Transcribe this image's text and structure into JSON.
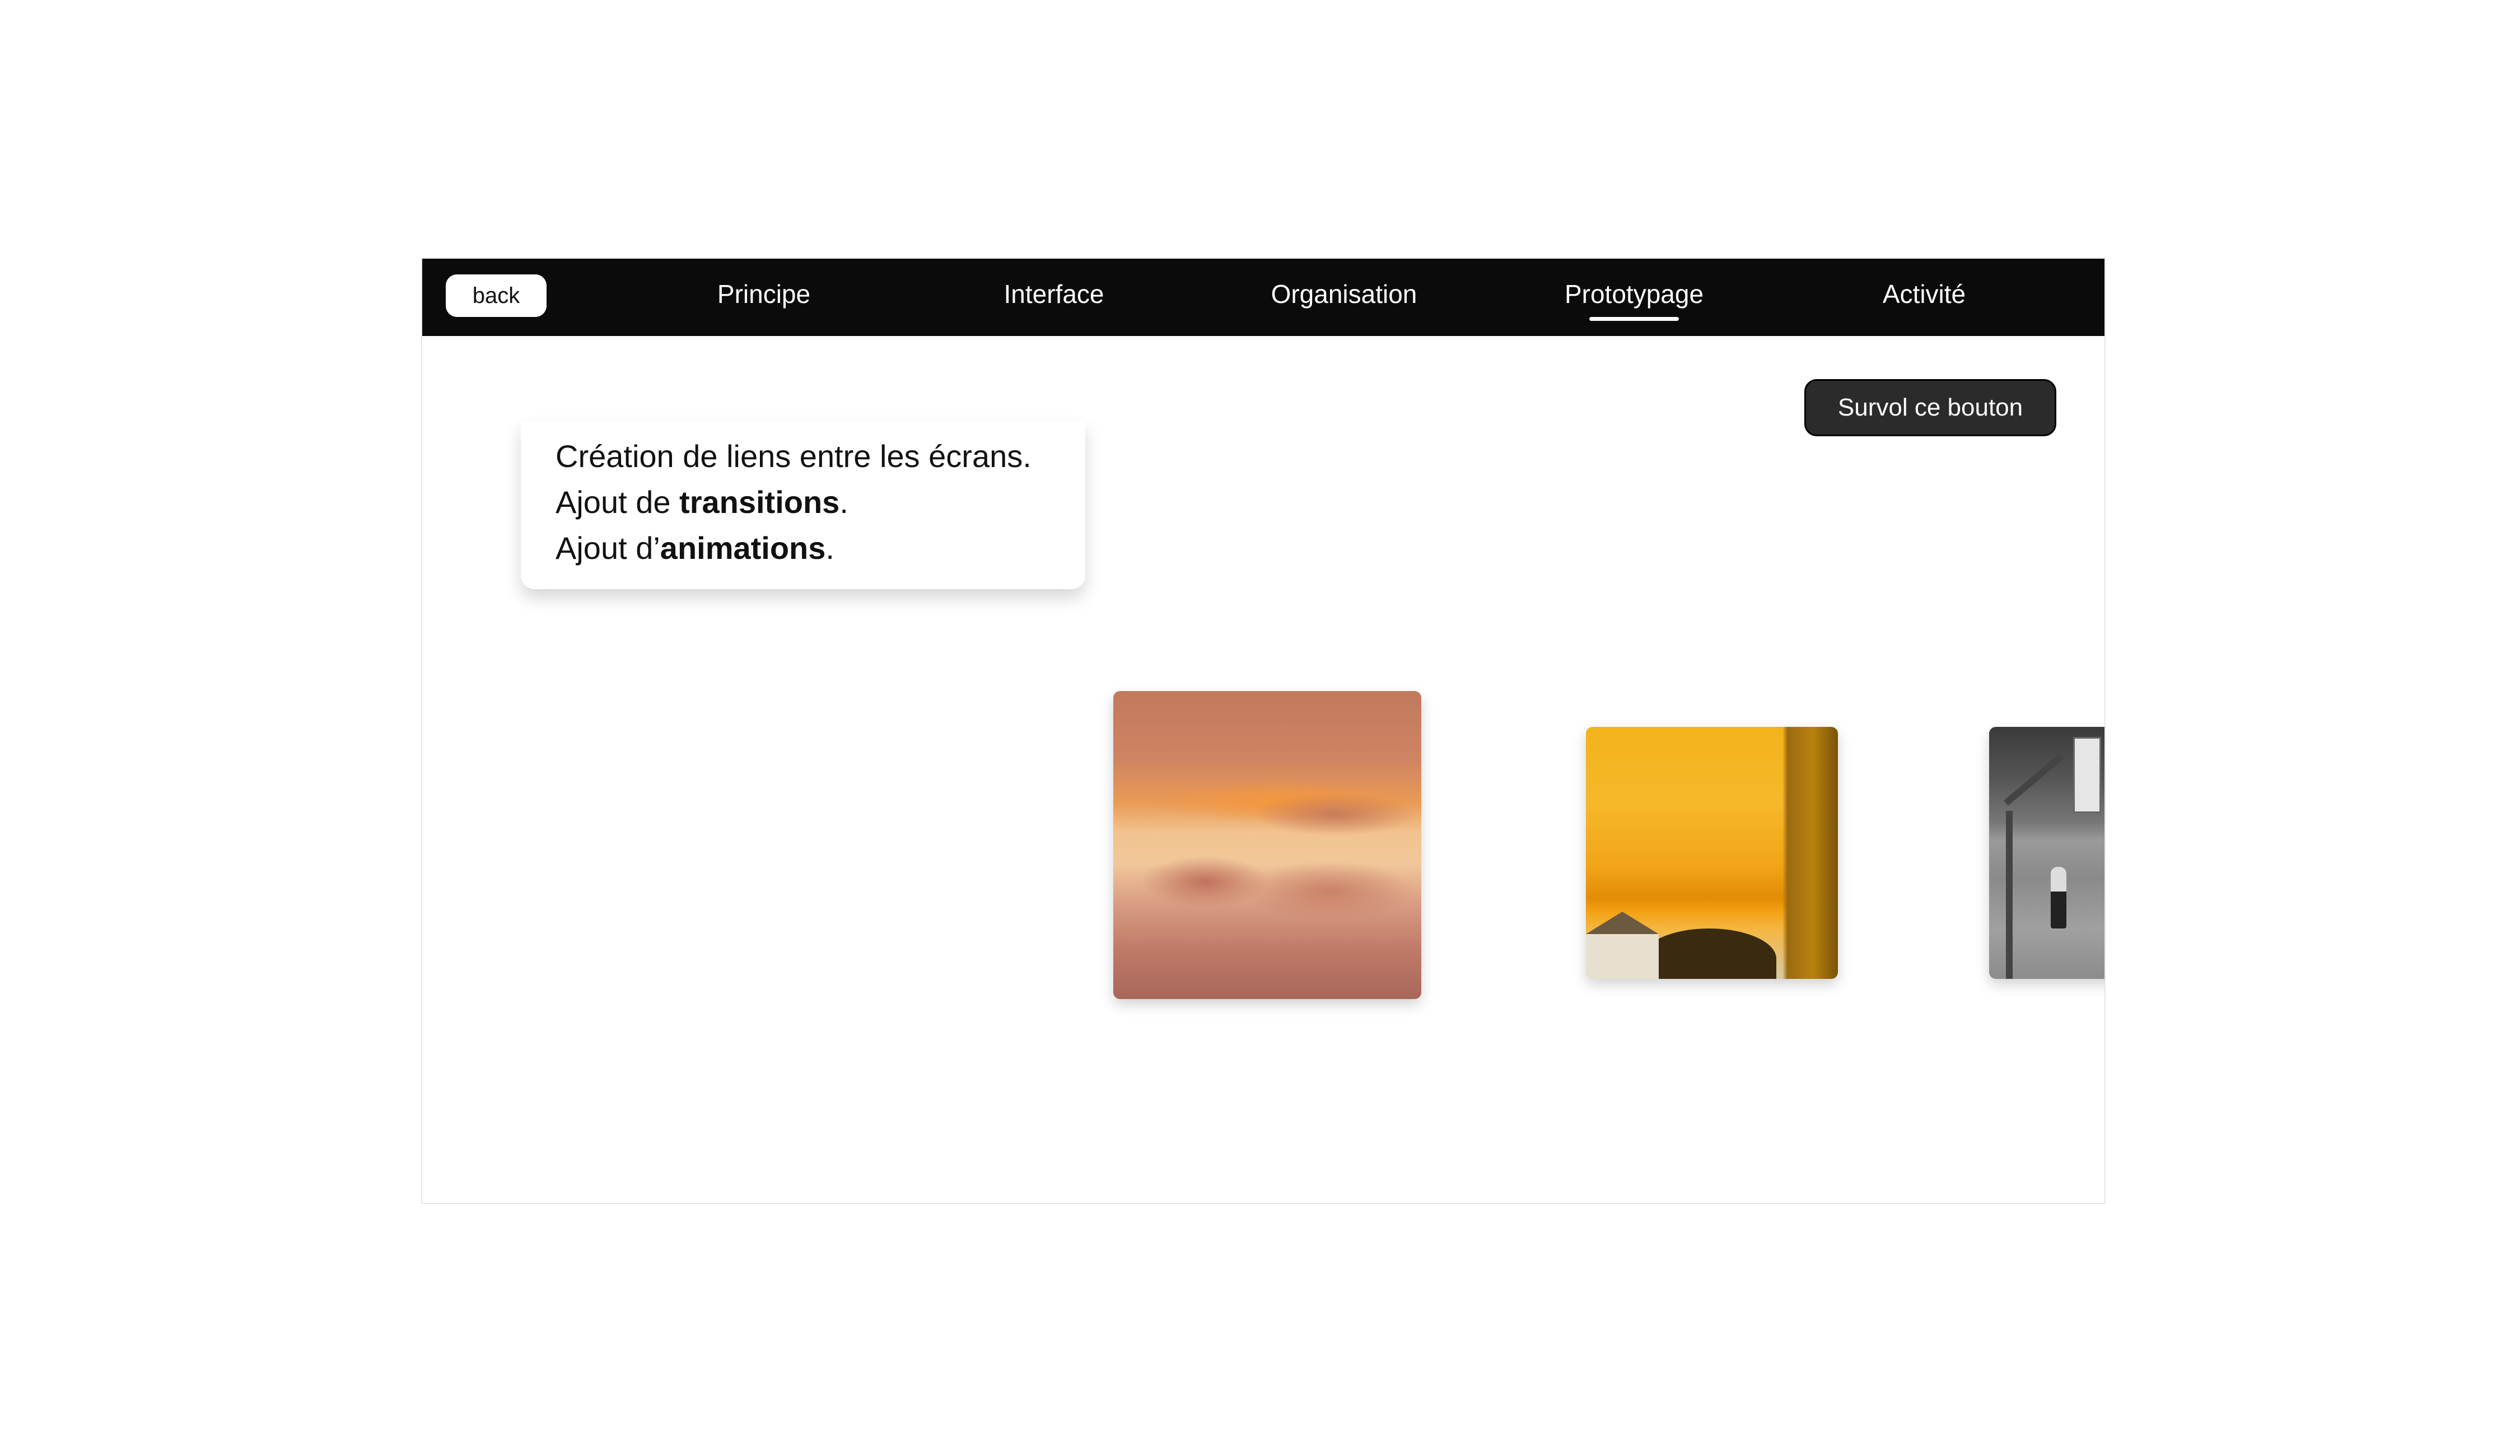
{
  "topbar": {
    "back_label": "back",
    "nav": [
      {
        "label": "Principe",
        "active": false
      },
      {
        "label": "Interface",
        "active": false
      },
      {
        "label": "Organisation",
        "active": false
      },
      {
        "label": "Prototypage",
        "active": true
      },
      {
        "label": "Activité",
        "active": false
      }
    ]
  },
  "hover_button": {
    "label": "Survol ce bouton"
  },
  "card": {
    "line1": "Création de liens entre les écrans.",
    "line2_prefix": "Ajout de ",
    "line2_bold": "transitions",
    "line2_suffix": ".",
    "line3_prefix": "Ajout d’",
    "line3_bold": "animations",
    "line3_suffix": "."
  },
  "colors": {
    "topbar_bg": "#0b0b0b",
    "hover_button_bg": "#2b2b2b"
  }
}
